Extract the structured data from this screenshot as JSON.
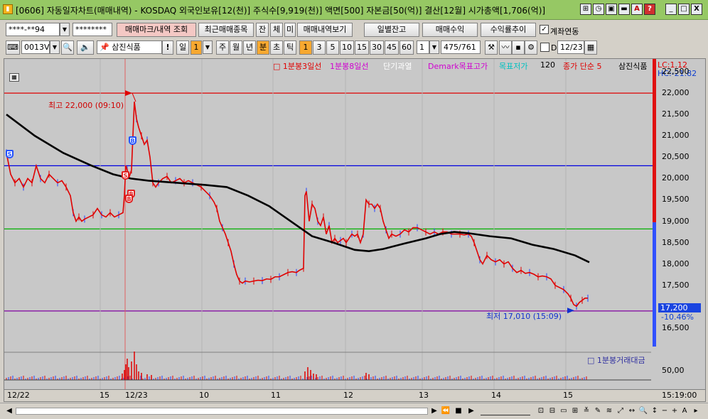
{
  "window": {
    "title": "[0606] 자동일자차트(매매내역) - KOSDAQ 외국인보유[12(천)] 주식수[9,919(천)] 액면[500] 자본금[50(억)] 결산[12월] 시가총액[1,706(억)]",
    "icon": "chart-app-icon",
    "title_buttons": [
      "⊞",
      "◷",
      "▣",
      "▬",
      "A",
      "?"
    ],
    "min": "_",
    "max": "□",
    "close": "X"
  },
  "toolbar1": {
    "account": "****-**94",
    "password": "********",
    "buttons": [
      "매매마크/내역 조회",
      "최근매매종목",
      "잔",
      "체",
      "미",
      "매매내역보기"
    ],
    "right_buttons": [
      "일별잔고",
      "매매수익",
      "수익률추이"
    ],
    "linked_label": "계좌연동",
    "linked_checked": "✓"
  },
  "toolbar2": {
    "stock_code": "0013V0",
    "stock_name": "삼진식품",
    "bang": "!",
    "period": "일",
    "period_num": "1",
    "periods": [
      "주",
      "월",
      "년",
      "분",
      "초",
      "틱"
    ],
    "active_period": "분",
    "intervals": [
      "1",
      "3",
      "5",
      "10",
      "15",
      "30",
      "45",
      "60"
    ],
    "active_interval": "1",
    "interval_value": "1",
    "count": "475",
    "count_total": "/761",
    "d_label": "D",
    "date": "12/23"
  },
  "chart": {
    "legend": [
      {
        "text": "□ 1분봉3일선",
        "color": "#e00000"
      },
      {
        "text": "1분봉8일선",
        "color": "#d000d0"
      },
      {
        "text": "단기과열",
        "color": "#ffffff"
      },
      {
        "text": "Demark목표고가",
        "color": "#d000d0"
      },
      {
        "text": "목표저가",
        "color": "#00c0c0"
      },
      {
        "text": "120",
        "color": "#000000"
      },
      {
        "text": "종가 단순 5",
        "color": "#e00000"
      },
      {
        "text": "삼진식품",
        "color": "#000000"
      }
    ],
    "lc": "LC:1.12",
    "hc": "HC:-21.82",
    "y_ticks": [
      "22,500",
      "22,000",
      "21,500",
      "21,000",
      "20,500",
      "20,000",
      "19,500",
      "19,000",
      "18,500",
      "18,000",
      "17,500",
      "17,200",
      "16,500"
    ],
    "current_price": "17,200",
    "current_change": "-10.46%",
    "high_label": "최고 22,000 (09:10)",
    "low_label": "최저 17,010 (15:09)",
    "volume_legend": "□ 1분봉거래대금",
    "volume_tick": "50,00",
    "x_ticks": [
      "12/22",
      "15",
      "12/23",
      "10",
      "11",
      "12",
      "13",
      "14",
      "15"
    ],
    "time_label": "15:19:00",
    "markers": [
      "S",
      "B",
      "S",
      "B",
      "B"
    ]
  },
  "chart_data": {
    "type": "candlestick",
    "ylim": [
      16100,
      22600
    ],
    "hlines": [
      {
        "value": 22000,
        "color": "#e00000"
      },
      {
        "value": 20300,
        "color": "#0000e0"
      },
      {
        "value": 18820,
        "color": "#00b000"
      },
      {
        "value": 16900,
        "color": "#8000a0"
      }
    ],
    "price_series": [
      [
        0,
        20600
      ],
      [
        6,
        20100
      ],
      [
        12,
        19900
      ],
      [
        18,
        20000
      ],
      [
        24,
        19800
      ],
      [
        30,
        20000
      ],
      [
        36,
        19900
      ],
      [
        42,
        20300
      ],
      [
        48,
        20000
      ],
      [
        54,
        19900
      ],
      [
        60,
        20100
      ],
      [
        66,
        20000
      ],
      [
        72,
        19900
      ],
      [
        78,
        19950
      ],
      [
        84,
        19800
      ],
      [
        90,
        19600
      ],
      [
        94,
        19200
      ],
      [
        98,
        19000
      ],
      [
        102,
        19100
      ],
      [
        106,
        19000
      ],
      [
        110,
        19050
      ],
      [
        116,
        19100
      ],
      [
        122,
        19150
      ],
      [
        128,
        19300
      ],
      [
        134,
        19150
      ],
      [
        140,
        19100
      ],
      [
        146,
        19200
      ],
      [
        152,
        19100
      ],
      [
        158,
        19150
      ],
      [
        164,
        19200
      ],
      [
        166,
        19600
      ],
      [
        168,
        20300
      ],
      [
        170,
        20200
      ],
      [
        172,
        20000
      ],
      [
        176,
        20200
      ],
      [
        180,
        21800
      ],
      [
        183,
        21400
      ],
      [
        186,
        21200
      ],
      [
        190,
        21000
      ],
      [
        194,
        20800
      ],
      [
        198,
        20900
      ],
      [
        202,
        20500
      ],
      [
        206,
        19900
      ],
      [
        210,
        19800
      ],
      [
        214,
        19900
      ],
      [
        220,
        20000
      ],
      [
        226,
        20050
      ],
      [
        232,
        19900
      ],
      [
        238,
        19950
      ],
      [
        244,
        20000
      ],
      [
        250,
        19900
      ],
      [
        256,
        19950
      ],
      [
        262,
        19900
      ],
      [
        268,
        19850
      ],
      [
        274,
        19800
      ],
      [
        280,
        19700
      ],
      [
        286,
        19600
      ],
      [
        292,
        19450
      ],
      [
        296,
        19300
      ],
      [
        300,
        19000
      ],
      [
        304,
        18850
      ],
      [
        308,
        18700
      ],
      [
        312,
        18500
      ],
      [
        316,
        18300
      ],
      [
        320,
        18000
      ],
      [
        324,
        17750
      ],
      [
        328,
        17600
      ],
      [
        332,
        17550
      ],
      [
        336,
        17600
      ],
      [
        342,
        17580
      ],
      [
        348,
        17600
      ],
      [
        354,
        17620
      ],
      [
        360,
        17610
      ],
      [
        366,
        17650
      ],
      [
        372,
        17640
      ],
      [
        378,
        17700
      ],
      [
        384,
        17700
      ],
      [
        390,
        17750
      ],
      [
        396,
        17800
      ],
      [
        402,
        17820
      ],
      [
        408,
        17800
      ],
      [
        412,
        17850
      ],
      [
        418,
        17900
      ],
      [
        420,
        19600
      ],
      [
        422,
        19700
      ],
      [
        426,
        19000
      ],
      [
        430,
        19400
      ],
      [
        434,
        19300
      ],
      [
        438,
        19000
      ],
      [
        442,
        18900
      ],
      [
        446,
        19100
      ],
      [
        450,
        18700
      ],
      [
        454,
        18900
      ],
      [
        458,
        18500
      ],
      [
        462,
        18600
      ],
      [
        466,
        18500
      ],
      [
        470,
        18550
      ],
      [
        474,
        18600
      ],
      [
        478,
        18500
      ],
      [
        482,
        18600
      ],
      [
        486,
        18700
      ],
      [
        490,
        18650
      ],
      [
        494,
        18700
      ],
      [
        498,
        18500
      ],
      [
        502,
        18700
      ],
      [
        506,
        19500
      ],
      [
        510,
        19400
      ],
      [
        514,
        19400
      ],
      [
        518,
        19300
      ],
      [
        522,
        19400
      ],
      [
        526,
        19300
      ],
      [
        530,
        19000
      ],
      [
        534,
        18800
      ],
      [
        538,
        18600
      ],
      [
        542,
        18700
      ],
      [
        548,
        18650
      ],
      [
        554,
        18700
      ],
      [
        560,
        18800
      ],
      [
        566,
        18750
      ],
      [
        572,
        18850
      ],
      [
        578,
        18850
      ],
      [
        584,
        18800
      ],
      [
        590,
        18750
      ],
      [
        596,
        18700
      ],
      [
        602,
        18750
      ],
      [
        608,
        18700
      ],
      [
        614,
        18750
      ],
      [
        620,
        18750
      ],
      [
        626,
        18700
      ],
      [
        632,
        18700
      ],
      [
        638,
        18700
      ],
      [
        644,
        18680
      ],
      [
        650,
        18700
      ],
      [
        654,
        18650
      ],
      [
        658,
        18500
      ],
      [
        662,
        18300
      ],
      [
        666,
        18100
      ],
      [
        670,
        18000
      ],
      [
        676,
        18200
      ],
      [
        682,
        18100
      ],
      [
        688,
        18050
      ],
      [
        694,
        18100
      ],
      [
        700,
        18000
      ],
      [
        706,
        18050
      ],
      [
        712,
        17900
      ],
      [
        718,
        17800
      ],
      [
        724,
        17850
      ],
      [
        730,
        17780
      ],
      [
        736,
        17800
      ],
      [
        742,
        17760
      ],
      [
        748,
        17700
      ],
      [
        754,
        17720
      ],
      [
        760,
        17700
      ],
      [
        766,
        17650
      ],
      [
        772,
        17500
      ],
      [
        778,
        17450
      ],
      [
        784,
        17400
      ],
      [
        790,
        17300
      ],
      [
        794,
        17200
      ],
      [
        798,
        17050
      ],
      [
        802,
        17010
      ],
      [
        806,
        17100
      ],
      [
        810,
        17150
      ],
      [
        814,
        17200
      ],
      [
        818,
        17200
      ]
    ],
    "ma120_series": [
      [
        0,
        21500
      ],
      [
        40,
        21000
      ],
      [
        80,
        20600
      ],
      [
        120,
        20300
      ],
      [
        150,
        20100
      ],
      [
        175,
        20000
      ],
      [
        200,
        19950
      ],
      [
        240,
        19900
      ],
      [
        280,
        19850
      ],
      [
        310,
        19800
      ],
      [
        340,
        19600
      ],
      [
        370,
        19350
      ],
      [
        400,
        19000
      ],
      [
        430,
        18650
      ],
      [
        460,
        18500
      ],
      [
        490,
        18330
      ],
      [
        510,
        18300
      ],
      [
        530,
        18350
      ],
      [
        560,
        18480
      ],
      [
        590,
        18600
      ],
      [
        610,
        18700
      ],
      [
        630,
        18750
      ],
      [
        650,
        18720
      ],
      [
        680,
        18650
      ],
      [
        710,
        18600
      ],
      [
        740,
        18450
      ],
      [
        770,
        18350
      ],
      [
        800,
        18200
      ],
      [
        820,
        18040
      ]
    ],
    "volume_spikes": [
      [
        163,
        9
      ],
      [
        166,
        14
      ],
      [
        168,
        22
      ],
      [
        170,
        30
      ],
      [
        172,
        18
      ],
      [
        176,
        26
      ],
      [
        180,
        40
      ],
      [
        183,
        22
      ],
      [
        186,
        12
      ],
      [
        190,
        10
      ],
      [
        198,
        8
      ],
      [
        204,
        7
      ],
      [
        420,
        12
      ],
      [
        424,
        18
      ],
      [
        428,
        14
      ],
      [
        432,
        9
      ],
      [
        436,
        8
      ],
      [
        506,
        10
      ],
      [
        510,
        8
      ]
    ]
  }
}
